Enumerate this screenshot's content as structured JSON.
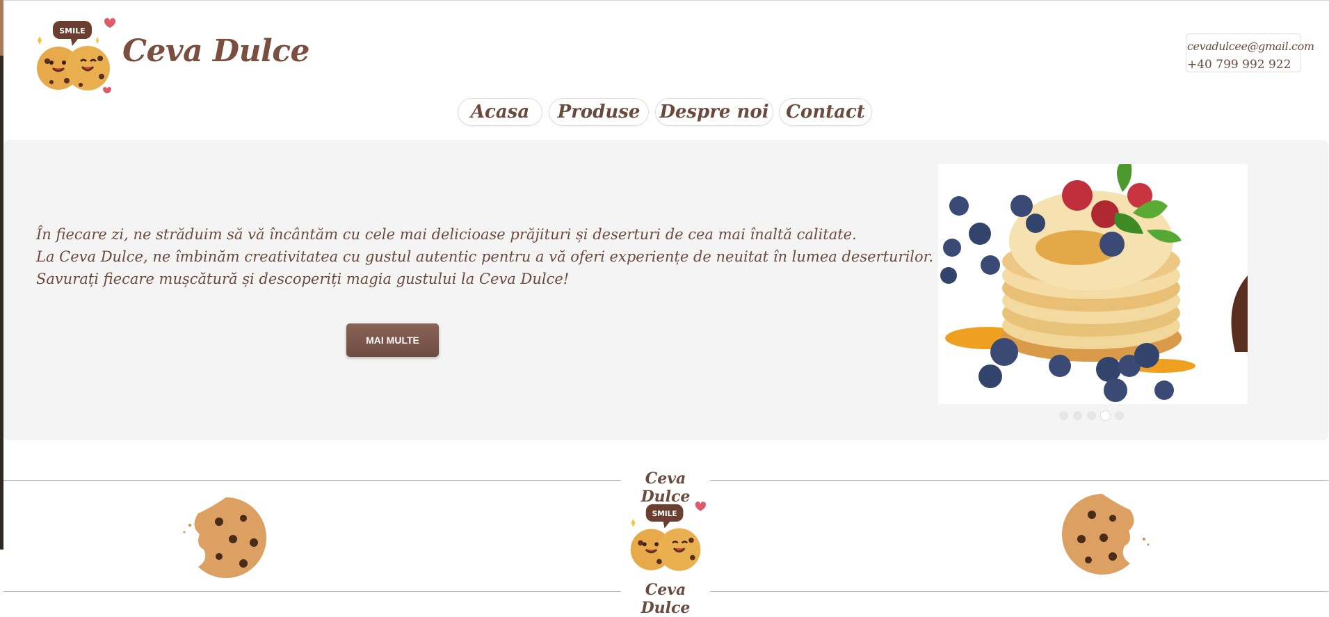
{
  "brand": {
    "name": "Ceva Dulce",
    "logo_text": "SMILE"
  },
  "contact": {
    "email": "cevadulcee@gmail.com",
    "phone": "+40 799 992 922"
  },
  "nav": [
    {
      "label": "Acasa"
    },
    {
      "label": "Produse"
    },
    {
      "label": "Despre noi"
    },
    {
      "label": "Contact"
    }
  ],
  "hero": {
    "lines": [
      "În fiecare zi, ne străduim să vă încântăm cu cele mai delicioase prăjituri și deserturi de cea mai înaltă calitate.",
      "La Ceva Dulce, ne îmbinăm creativitatea cu gustul autentic pentru a vă oferi experiențe de neuitat în lumea deserturilor.",
      "Savurați fiecare mușcătură și descoperiți magia gustului la Ceva Dulce!"
    ],
    "button_label": "MAI MULTE"
  },
  "carousel": {
    "slide_count": 5,
    "active_index": 3,
    "image": "pancakes-with-berries"
  },
  "footer": {
    "top_label": "Ceva Dulce",
    "bottom_label": "Ceva Dulce"
  },
  "colors": {
    "brand_brown": "#6b4a3e",
    "button": "#7a5649",
    "hero_bg": "#f4f4f4"
  }
}
